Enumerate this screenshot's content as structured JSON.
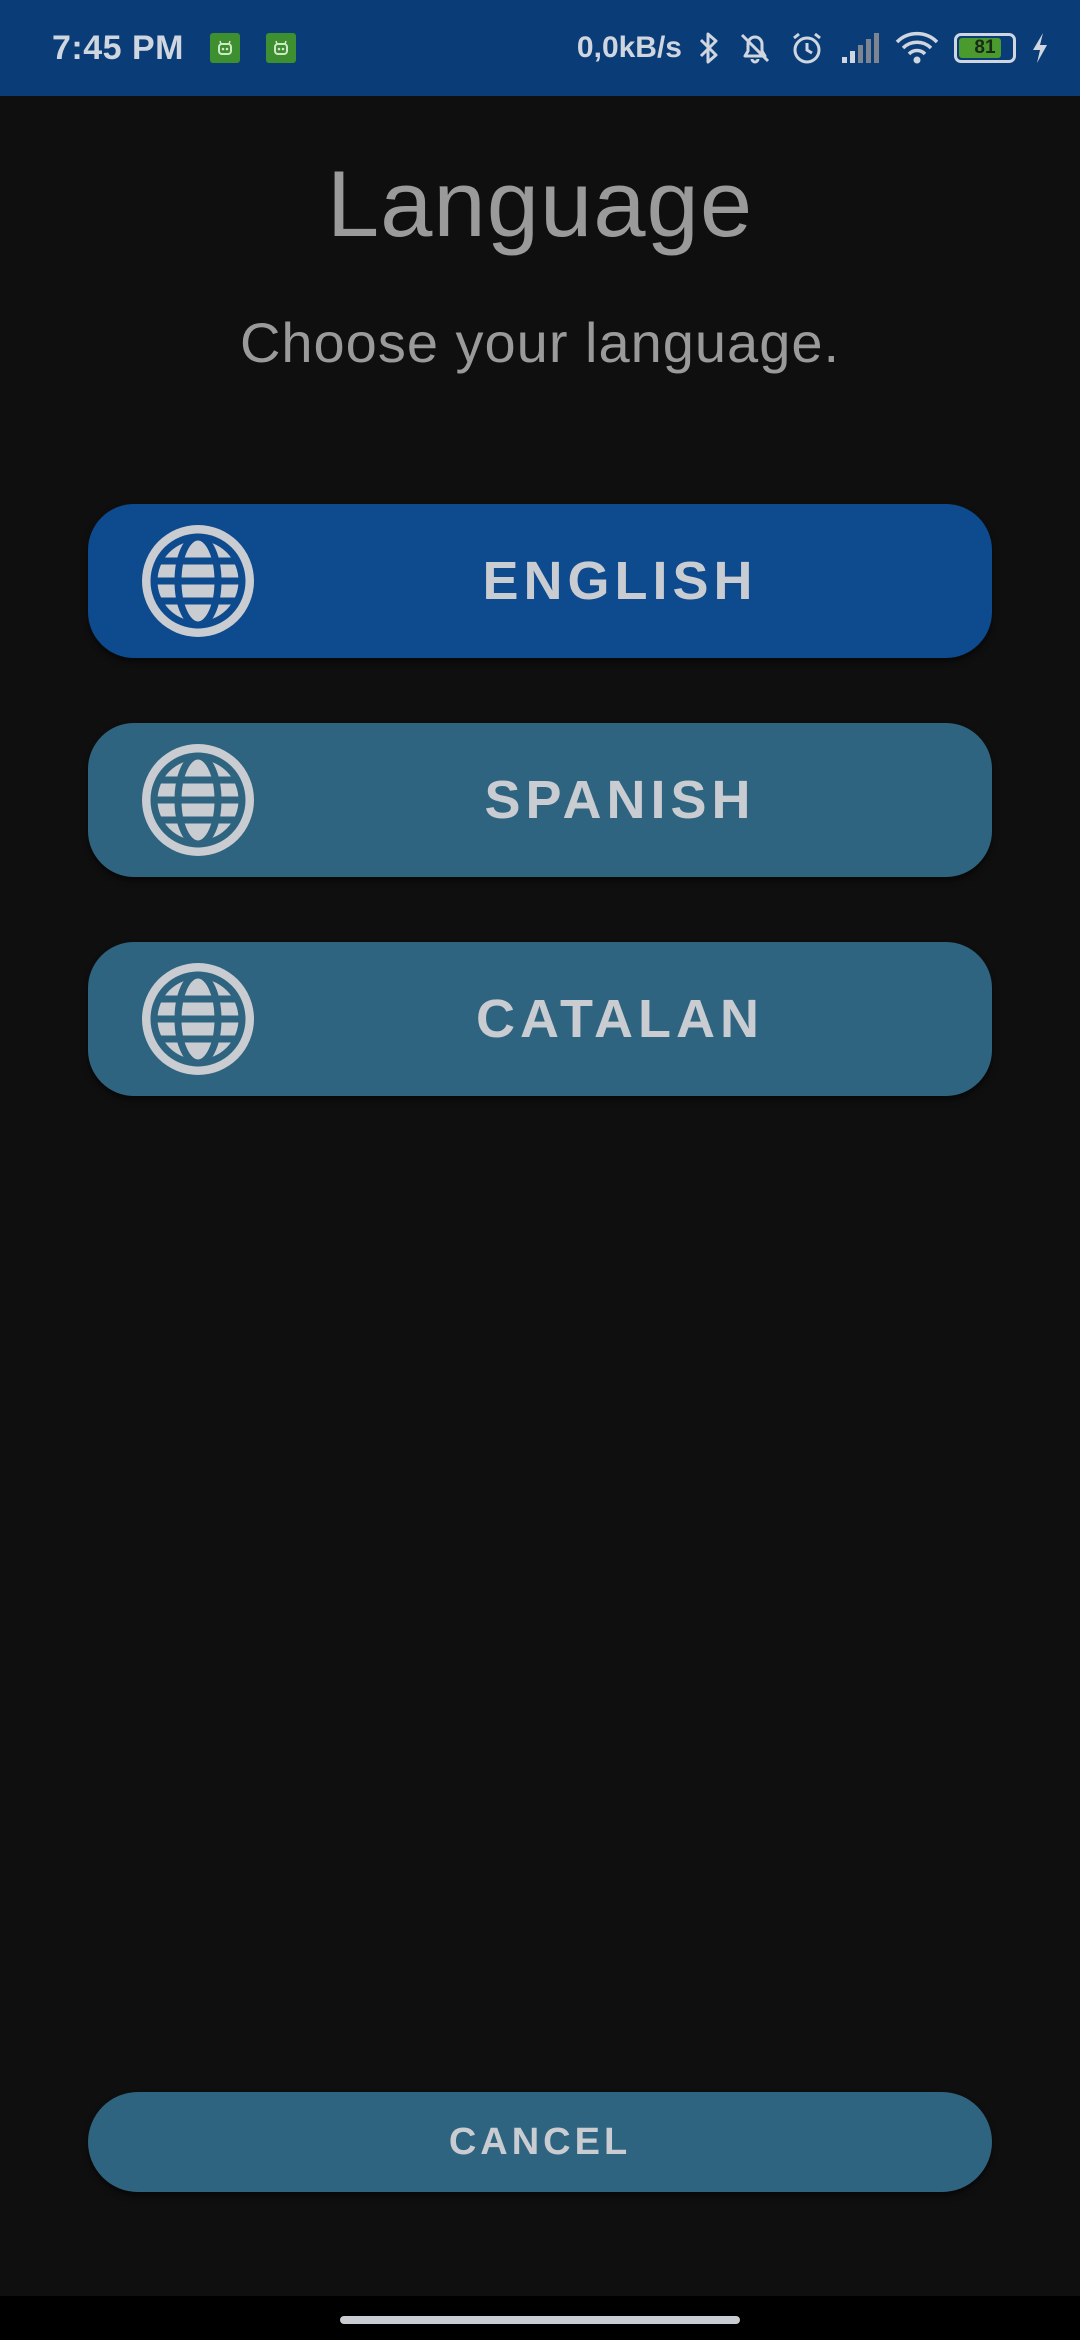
{
  "status_bar": {
    "time": "7:45 PM",
    "net_speed": "0,0kB/s",
    "battery_level": "81",
    "battery_fraction": 0.81,
    "icons": [
      "android-app-icon",
      "android-app-icon",
      "bluetooth-icon",
      "bell-muted-icon",
      "alarm-icon",
      "signal-icon",
      "wifi-icon",
      "battery-icon",
      "charging-icon"
    ]
  },
  "page": {
    "title": "Language",
    "subtitle": "Choose your language."
  },
  "languages": [
    {
      "label": "ENGLISH",
      "icon": "globe-icon",
      "selected": true,
      "color": "#0d4a8e"
    },
    {
      "label": "SPANISH",
      "icon": "globe-icon",
      "selected": false,
      "color": "#2f6480"
    },
    {
      "label": "CATALAN",
      "icon": "globe-icon",
      "selected": false,
      "color": "#2f6480"
    }
  ],
  "cancel_label": "CANCEL",
  "colors": {
    "status_bar": "#0a3d78",
    "background": "#0f0f0f",
    "selected_button": "#0d4a8e",
    "button": "#2f6480",
    "text": "#c9ccd0"
  }
}
